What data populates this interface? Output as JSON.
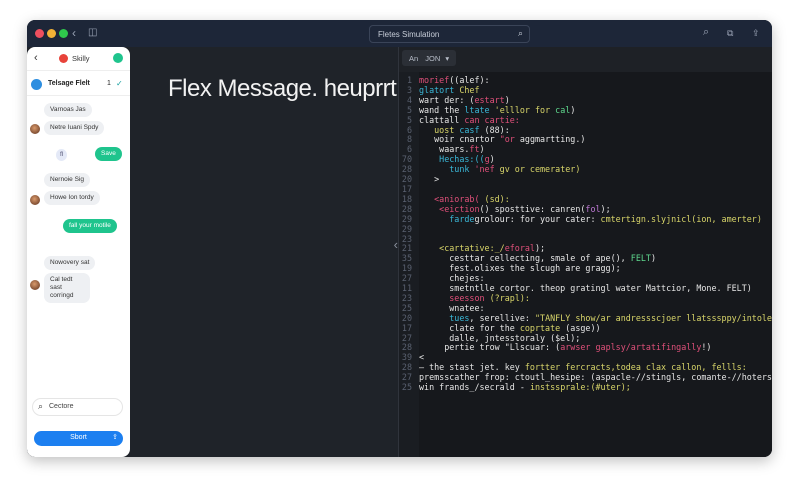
{
  "window": {
    "search_value": "Fletes Simulation"
  },
  "chat": {
    "app_name": "Skilly",
    "contact_name": "Telsage Flelt",
    "contact_badge": "1",
    "messages": [
      {
        "text": "Varnoas Jas",
        "from": "them"
      },
      {
        "text": "Netre Iuani Spdy",
        "from": "them"
      },
      {
        "text": "fl",
        "from": "chip"
      },
      {
        "text": "Save",
        "from": "me"
      },
      {
        "text": "Nernoie Sig",
        "from": "them"
      },
      {
        "text": "Howe Ion tordy",
        "from": "them"
      },
      {
        "text": "fall your motile",
        "from": "me"
      },
      {
        "text": "Nowovery sat",
        "from": "them"
      },
      {
        "text": "Cal tedt sast corringd",
        "from": "them"
      }
    ],
    "search_value": "Cectore",
    "primary_button": "Sbort"
  },
  "main": {
    "heading": "Flex Message. heuprrt."
  },
  "code": {
    "tab_prefix": "An",
    "tab_label": "JON",
    "colors": {
      "w": "#e6e6e6",
      "p": "#e0507a",
      "c": "#3ab8d8",
      "y": "#d9d66a",
      "g": "#5fd98e",
      "v": "#c07ad6"
    },
    "lines": [
      {
        "n": "1",
        "s": [
          [
            "morief",
            "p"
          ],
          [
            "((alef):",
            "w"
          ]
        ]
      },
      {
        "n": "3",
        "s": [
          [
            "glatort",
            "c"
          ],
          [
            " Chef",
            "y"
          ]
        ]
      },
      {
        "n": "4",
        "s": [
          [
            "wart der: (",
            "w"
          ],
          [
            "estart",
            "p"
          ],
          [
            ")",
            "w"
          ]
        ]
      },
      {
        "n": "5",
        "s": [
          [
            "wand the ",
            "w"
          ],
          [
            "ltate",
            "c"
          ],
          [
            " 'elllor for ",
            "y"
          ],
          [
            "cal",
            "g"
          ],
          [
            ")",
            "w"
          ]
        ]
      },
      {
        "n": "5",
        "s": [
          [
            "clattall ",
            "w"
          ],
          [
            "can cartie:",
            "p"
          ]
        ]
      },
      {
        "n": "6",
        "s": [
          [
            "   uost ",
            "y"
          ],
          [
            "casf",
            "c"
          ],
          [
            " (88):",
            "w"
          ]
        ]
      },
      {
        "n": "8",
        "s": [
          [
            "   woir cnartor ",
            "w"
          ],
          [
            "\"or",
            "p"
          ],
          [
            " aggmartting.)",
            "w"
          ]
        ]
      },
      {
        "n": "6",
        "s": [
          [
            "    waars.",
            "w"
          ],
          [
            "ft",
            "p"
          ],
          [
            ")",
            "w"
          ]
        ]
      },
      {
        "n": "70",
        "s": [
          [
            "    Hechas:((",
            "c"
          ],
          [
            "g",
            "p"
          ],
          [
            ")",
            "w"
          ]
        ]
      },
      {
        "n": "28",
        "s": [
          [
            "      tunk ",
            "c"
          ],
          [
            "'nef",
            "p"
          ],
          [
            " gv or cemerater)",
            "y"
          ]
        ]
      },
      {
        "n": "20",
        "s": [
          [
            "   >",
            "w"
          ]
        ]
      },
      {
        "n": "17",
        "s": [
          [
            "",
            "w"
          ]
        ]
      },
      {
        "n": "18",
        "s": [
          [
            "   <aniorab(",
            "p"
          ],
          [
            " (sd):",
            "y"
          ]
        ]
      },
      {
        "n": "28",
        "s": [
          [
            "    <eiction",
            "p"
          ],
          [
            "() sposttive: canren(",
            "w"
          ],
          [
            "fol",
            "v"
          ],
          [
            ");",
            "w"
          ]
        ]
      },
      {
        "n": "29",
        "s": [
          [
            "      farde",
            "c"
          ],
          [
            "grolour: for your cater: ",
            "w"
          ],
          [
            "cmtertign.slyjnicl(ion, amerter)",
            "y"
          ]
        ]
      },
      {
        "n": "29",
        "s": [
          [
            "",
            "w"
          ]
        ]
      },
      {
        "n": "23",
        "s": [
          [
            "",
            "w"
          ]
        ]
      },
      {
        "n": "21",
        "s": [
          [
            "    <cartative:_/",
            "y"
          ],
          [
            "eforal",
            "p"
          ],
          [
            ");",
            "w"
          ]
        ]
      },
      {
        "n": "35",
        "s": [
          [
            "      cesttar cellecting, smale of ape(), ",
            "w"
          ],
          [
            "FELT",
            "g"
          ],
          [
            ")",
            "w"
          ]
        ]
      },
      {
        "n": "19",
        "s": [
          [
            "      fest.olixes the slcugh are gragg);",
            "w"
          ]
        ]
      },
      {
        "n": "27",
        "s": [
          [
            "      chejes:",
            "w"
          ]
        ]
      },
      {
        "n": "11",
        "s": [
          [
            "      smetntlle cortor. theop gratingl water Mattcior, Mone. FELT)",
            "w"
          ]
        ]
      },
      {
        "n": "23",
        "s": [
          [
            "      seesson",
            "p"
          ],
          [
            " (?rapl):",
            "y"
          ]
        ]
      },
      {
        "n": "25",
        "s": [
          [
            "      wnatee:",
            "w"
          ]
        ]
      },
      {
        "n": "20",
        "s": [
          [
            "      tues",
            "c"
          ],
          [
            ", serellive: ",
            "w"
          ],
          [
            "\"TANFLY show/ar andressscjoer llatsssppy/intole FELT)",
            "y"
          ]
        ]
      },
      {
        "n": "17",
        "s": [
          [
            "      clate for the ",
            "w"
          ],
          [
            "coprtate",
            "y"
          ],
          [
            " (asge))",
            "w"
          ]
        ]
      },
      {
        "n": "27",
        "s": [
          [
            "      dalle, jntesstoraly ($el);",
            "w"
          ]
        ]
      },
      {
        "n": "28",
        "s": [
          [
            "     pertie trow \"Llscuar: (",
            "w"
          ],
          [
            "arwser gaplsy/artatifingally",
            "p"
          ],
          [
            "!)",
            "w"
          ]
        ]
      },
      {
        "n": "39",
        "s": [
          [
            "<",
            "w"
          ]
        ]
      },
      {
        "n": "28",
        "s": [
          [
            "— the stast jet. key ",
            "w"
          ],
          [
            "fortter fercracts,todea clax callon, fellls:",
            "y"
          ]
        ]
      },
      {
        "n": "27",
        "s": [
          [
            "premsscather frop: ctoutl_hesipe: (aspacle-//stingls, comante-//hoterstips(jo)",
            "w"
          ]
        ]
      },
      {
        "n": "25",
        "s": [
          [
            "win frands_/secrald - ",
            "w"
          ],
          [
            "instssprale:(#uter);",
            "y"
          ]
        ]
      }
    ]
  }
}
